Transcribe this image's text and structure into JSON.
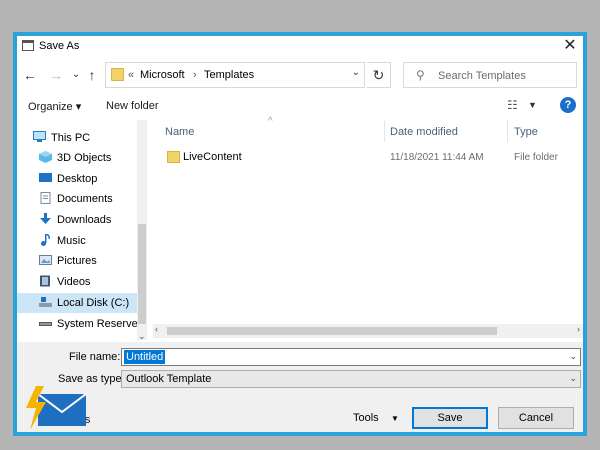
{
  "window": {
    "title": "Save As"
  },
  "address": {
    "prefix": "«",
    "crumbs": [
      "Microsoft",
      "Templates"
    ]
  },
  "search": {
    "placeholder": "Search Templates"
  },
  "toolbar": {
    "organize": "Organize ▾",
    "new_folder": "New folder"
  },
  "sidebar": {
    "items": [
      {
        "label": "This PC",
        "icon": "pc-icon"
      },
      {
        "label": "3D Objects",
        "icon": "cube-icon"
      },
      {
        "label": "Desktop",
        "icon": "desktop-icon"
      },
      {
        "label": "Documents",
        "icon": "documents-icon"
      },
      {
        "label": "Downloads",
        "icon": "download-icon"
      },
      {
        "label": "Music",
        "icon": "music-icon"
      },
      {
        "label": "Pictures",
        "icon": "pictures-icon"
      },
      {
        "label": "Videos",
        "icon": "videos-icon"
      },
      {
        "label": "Local Disk (C:)",
        "icon": "disk-icon",
        "selected": true
      },
      {
        "label": "System Reserved",
        "icon": "drive-icon"
      }
    ]
  },
  "columns": {
    "name": "Name",
    "date": "Date modified",
    "type": "Type"
  },
  "files": [
    {
      "name": "LiveContent",
      "date": "11/18/2021 11:44 AM",
      "type": "File folder"
    }
  ],
  "form": {
    "filename_label": "File name:",
    "filename_value": "Untitled",
    "savetype_label": "Save as type:",
    "savetype_value": "Outlook Template"
  },
  "footer": {
    "hide_folders": "ders",
    "tools": "Tools",
    "save": "Save",
    "cancel": "Cancel"
  }
}
